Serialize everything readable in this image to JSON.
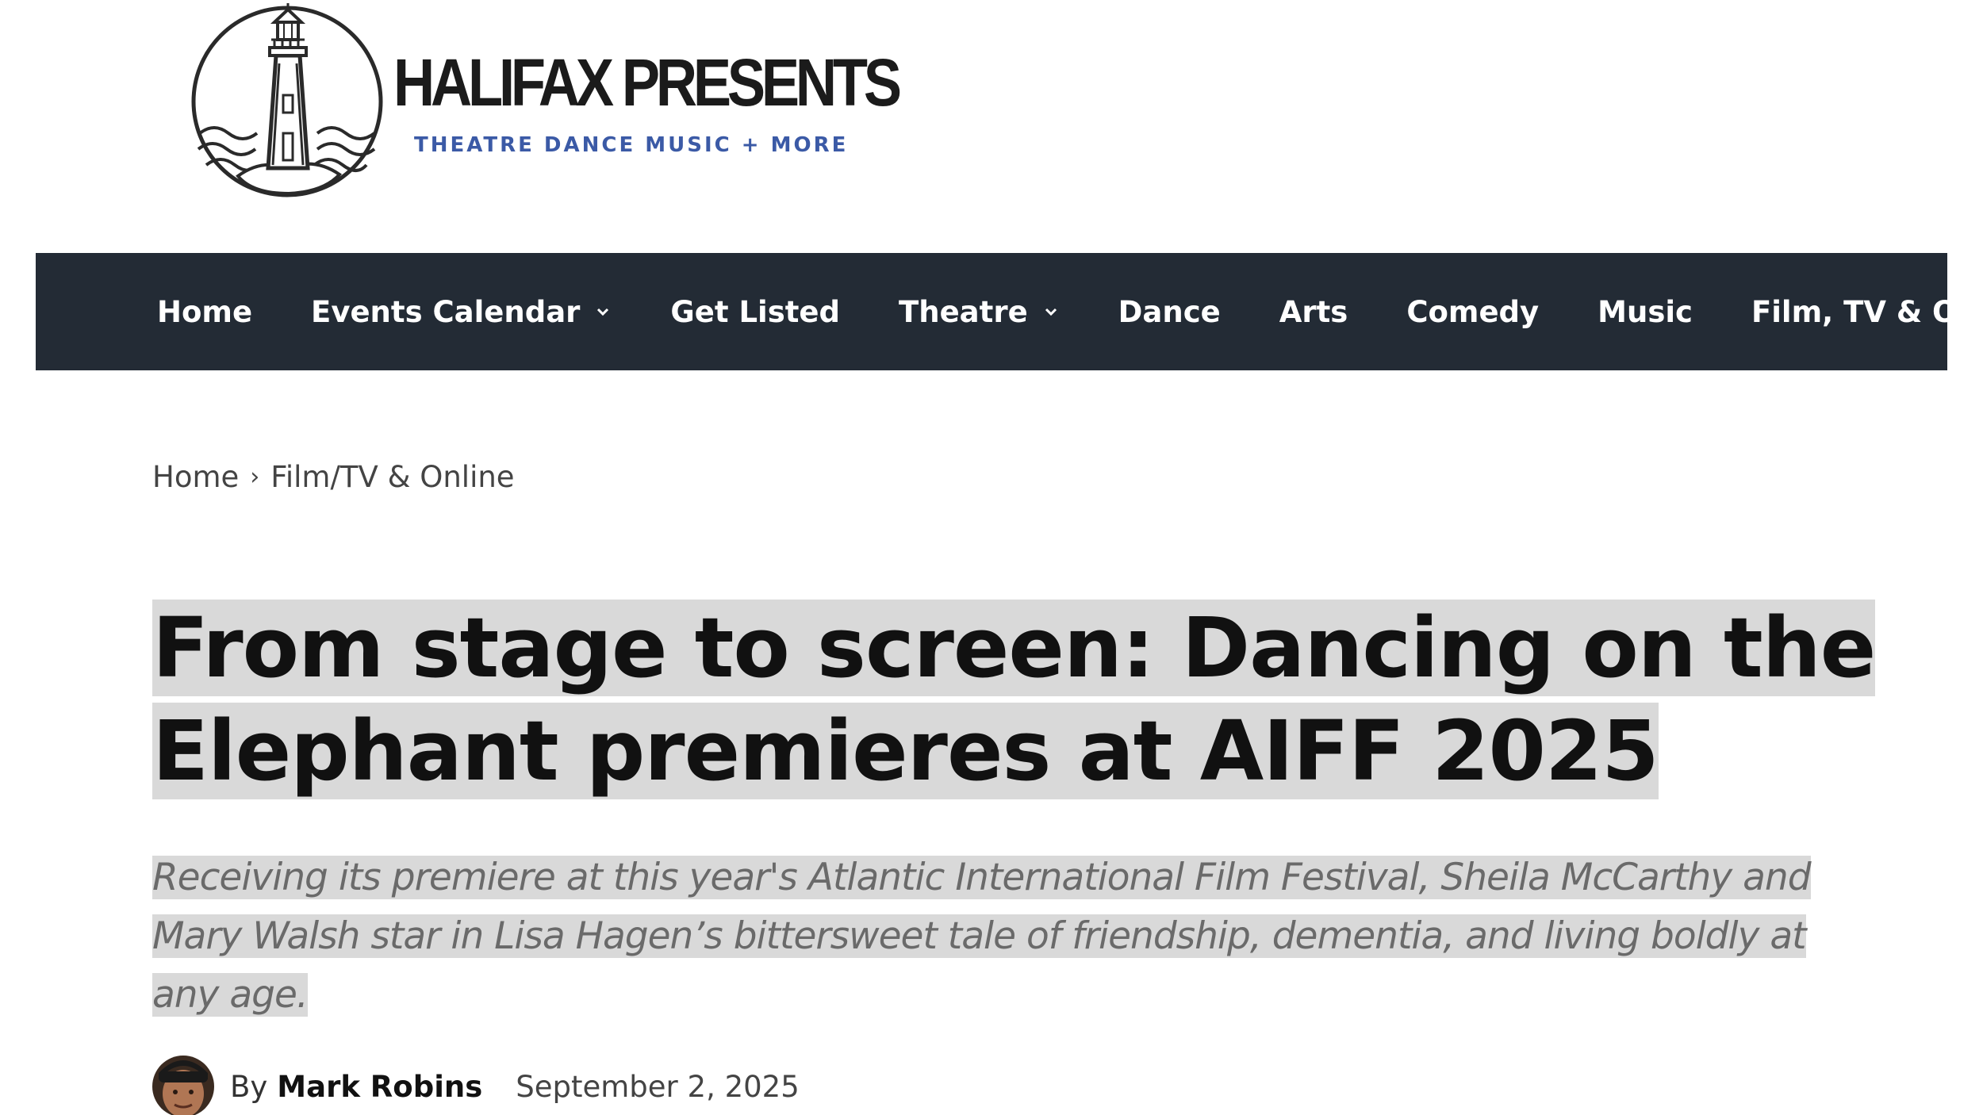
{
  "logo": {
    "title": "HALIFAX PRESENTS",
    "tagline": "THEATRE DANCE MUSIC + MORE",
    "tagline_color": "#3b5aa6",
    "icon": "lighthouse-icon"
  },
  "nav": {
    "background": "#232b35",
    "items": [
      {
        "label": "Home",
        "has_dropdown": false
      },
      {
        "label": "Events Calendar",
        "has_dropdown": true
      },
      {
        "label": "Get Listed",
        "has_dropdown": false
      },
      {
        "label": "Theatre",
        "has_dropdown": true
      },
      {
        "label": "Dance",
        "has_dropdown": false
      },
      {
        "label": "Arts",
        "has_dropdown": false
      },
      {
        "label": "Comedy",
        "has_dropdown": false
      },
      {
        "label": "Music",
        "has_dropdown": false
      },
      {
        "label": "Film, TV & Online",
        "has_dropdown": false
      }
    ]
  },
  "breadcrumb": {
    "home": "Home",
    "separator": "›",
    "current": "Film/TV & Online"
  },
  "article": {
    "title": "From stage to screen: Dancing on the Elephant premieres at AIFF 2025",
    "subtitle": "Receiving its premiere at this year's Atlantic International Film Festival, Sheila McCarthy and Mary Walsh star in Lisa Hagen’s bittersweet tale of friendship, dementia, and living boldly at any age.",
    "highlight_color": "#d9d9d9"
  },
  "byline": {
    "prefix": "By",
    "author": "Mark Robins",
    "date": "September 2, 2025"
  }
}
